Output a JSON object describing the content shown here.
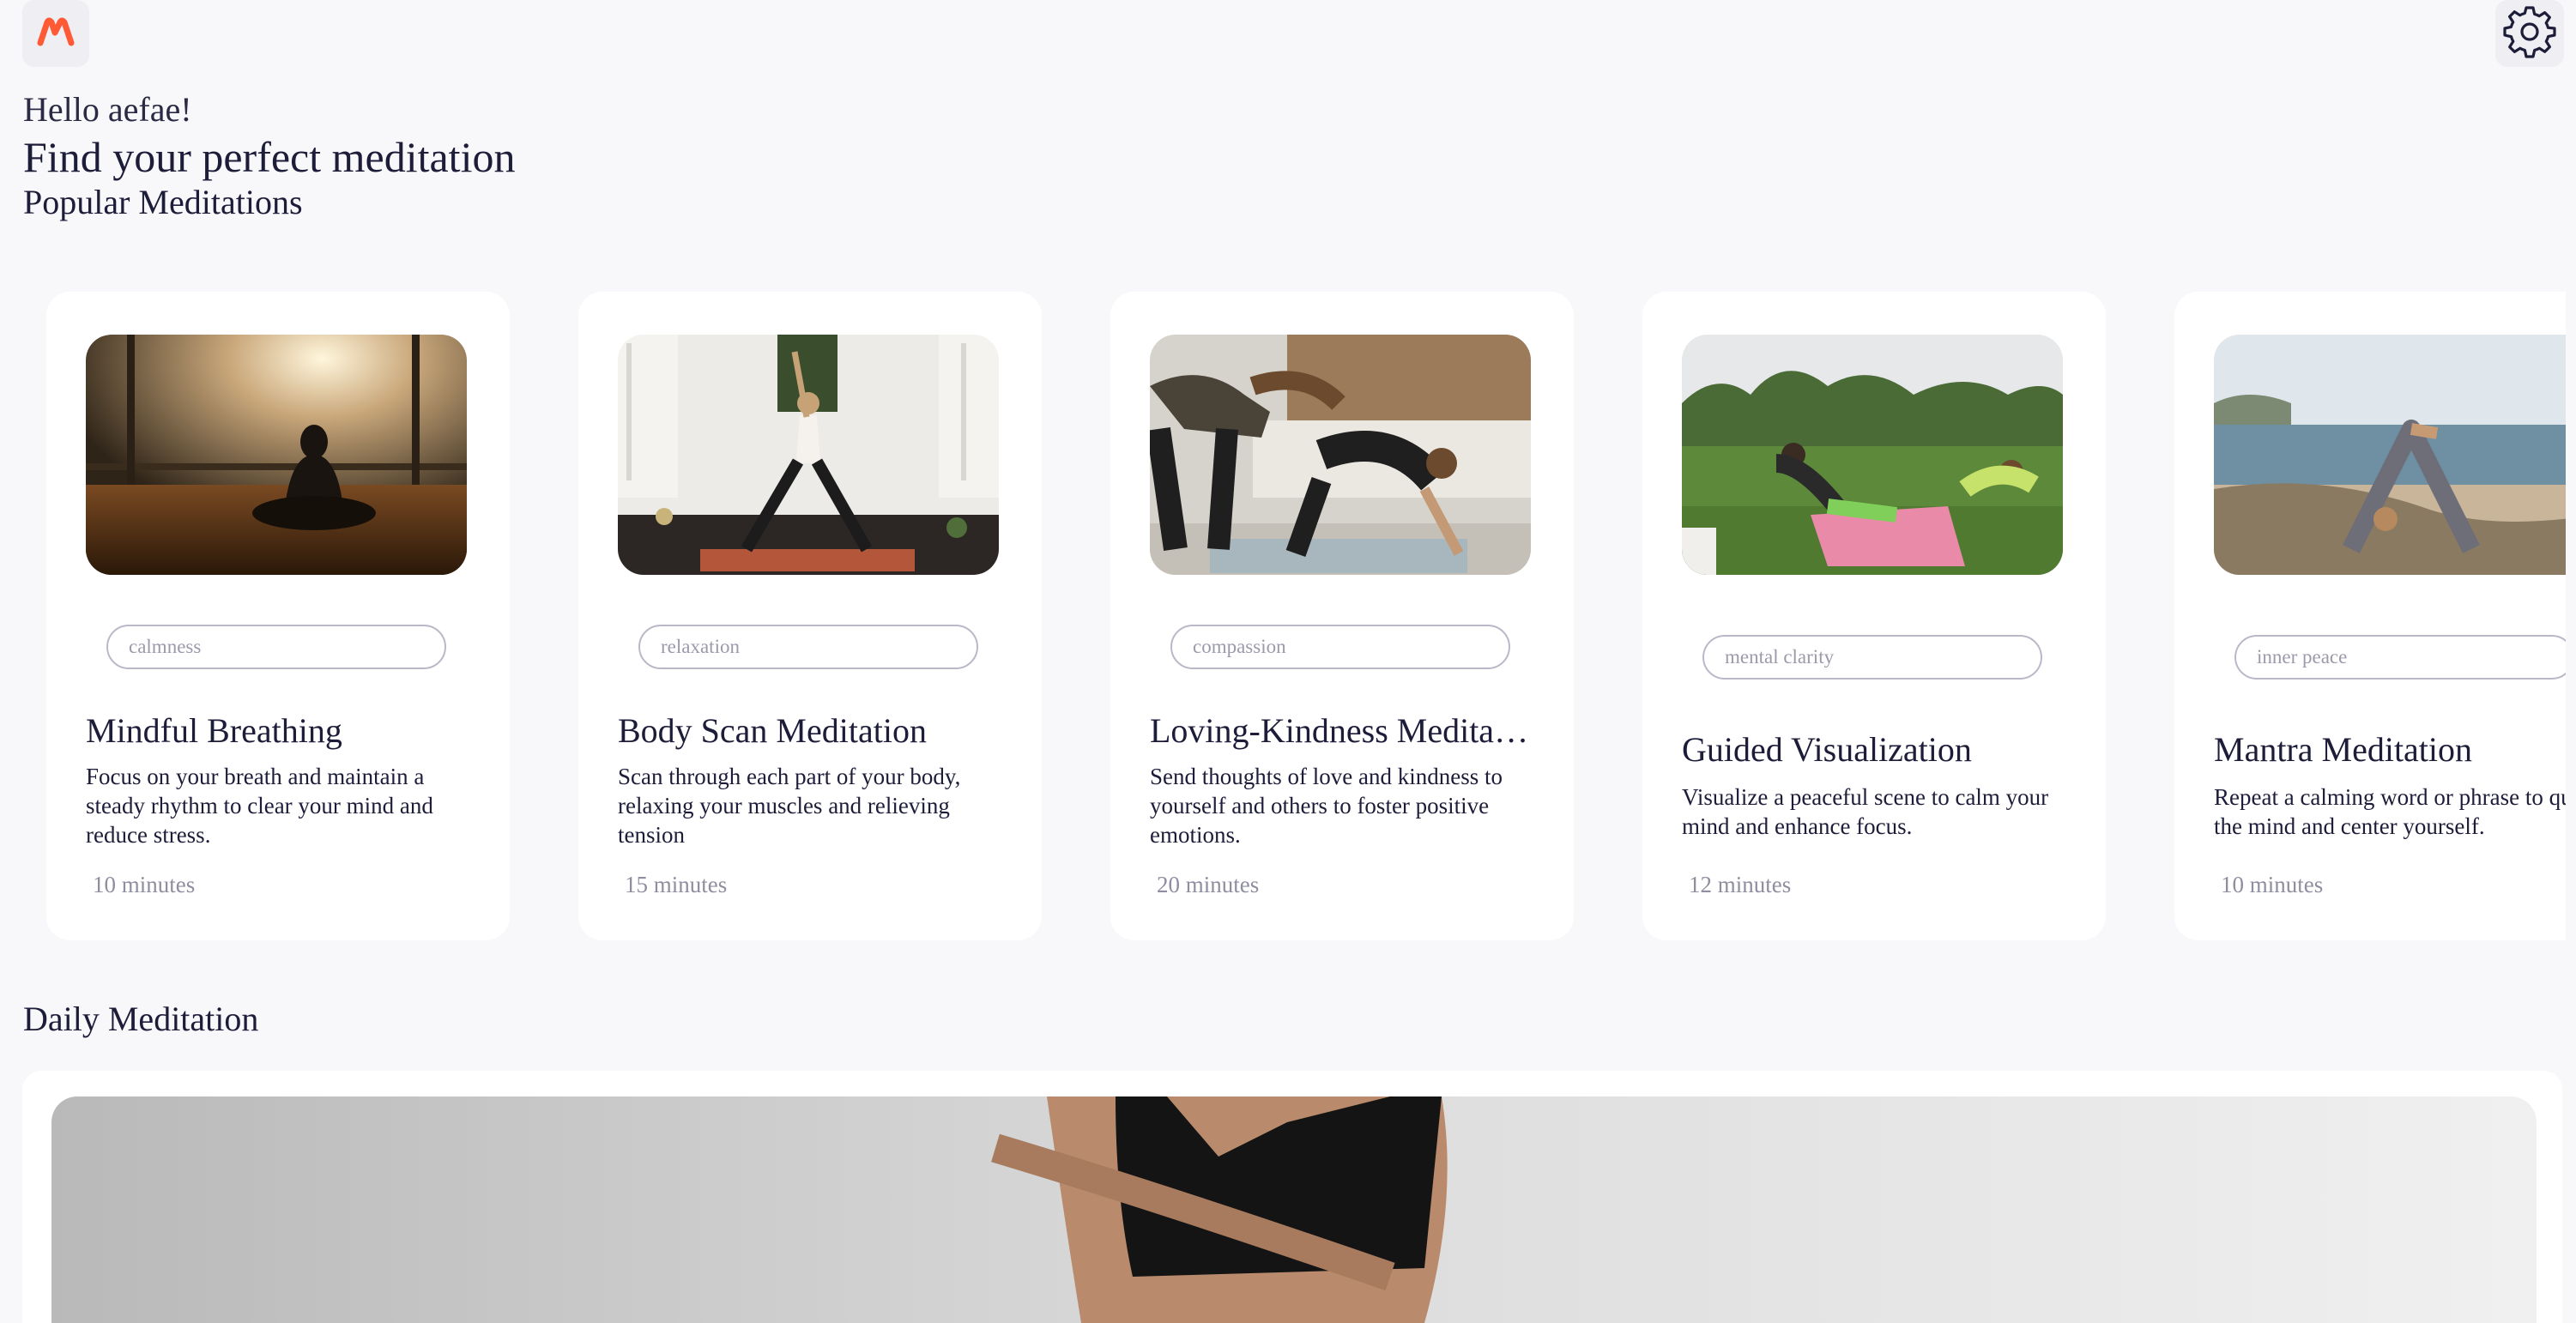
{
  "app": {
    "logo_icon": "m-logo-icon",
    "settings_icon": "gear-icon",
    "accent_color": "#ff5a36"
  },
  "header": {
    "greeting": "Hello aefae!",
    "headline": "Find your perfect meditation"
  },
  "popular": {
    "title": "Popular Meditations",
    "cards": [
      {
        "tag": "calmness",
        "title": "Mindful Breathing",
        "description": "Focus on your breath and maintain a steady rhythm to clear your mind and reduce stress.",
        "duration": "10 minutes"
      },
      {
        "tag": "relaxation",
        "title": "Body Scan Meditation",
        "description": "Scan through each part of your body, relaxing your muscles and relieving tension",
        "duration": "15 minutes"
      },
      {
        "tag": "compassion",
        "title": "Loving-Kindness Meditation",
        "description": "Send thoughts of love and kindness to yourself and others to foster positive emotions.",
        "duration": "20 minutes"
      },
      {
        "tag": "mental clarity",
        "title": "Guided Visualization",
        "description": "Visualize a peaceful scene to calm your mind and enhance focus.",
        "duration": "12 minutes"
      },
      {
        "tag": "inner peace",
        "title": "Mantra Meditation",
        "description": "Repeat a calming word or phrase to quiet the mind and center yourself.",
        "duration": "10 minutes"
      }
    ]
  },
  "daily": {
    "title": "Daily Meditation"
  }
}
